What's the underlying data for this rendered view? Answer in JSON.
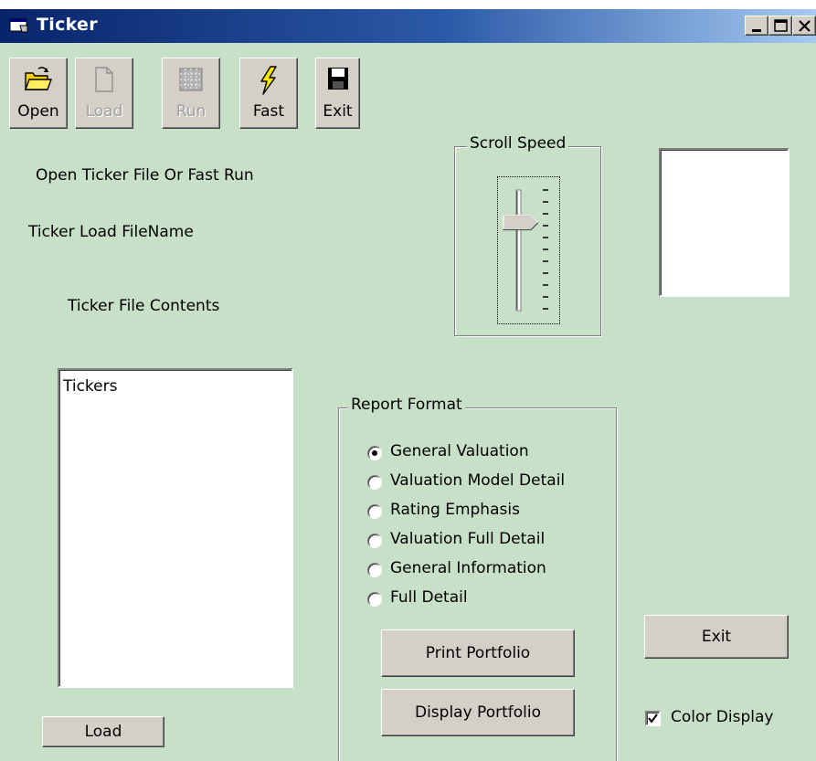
{
  "window": {
    "title": "Ticker"
  },
  "toolbar": {
    "open": "Open",
    "load": "Load",
    "run": "Run",
    "fast": "Fast",
    "exit": "Exit"
  },
  "labels": {
    "status": "Open Ticker File Or Fast Run",
    "filename": "Ticker Load FileName",
    "contents": "Ticker File  Contents"
  },
  "tickers_list": {
    "items": [
      "Tickers"
    ]
  },
  "scroll_speed": {
    "title": "Scroll Speed",
    "level": 0.27
  },
  "report_format": {
    "title": "Report Format",
    "options": [
      {
        "label": "General Valuation",
        "selected": true
      },
      {
        "label": "Valuation Model Detail",
        "selected": false
      },
      {
        "label": "Rating Emphasis",
        "selected": false
      },
      {
        "label": "Valuation Full Detail",
        "selected": false
      },
      {
        "label": "General Information",
        "selected": false
      },
      {
        "label": "Full Detail",
        "selected": false
      }
    ],
    "print_button": "Print Portfolio",
    "display_button": "Display Portfolio"
  },
  "buttons": {
    "load": "Load",
    "exit": "Exit"
  },
  "color_display": {
    "label": "Color Display",
    "checked": true
  }
}
